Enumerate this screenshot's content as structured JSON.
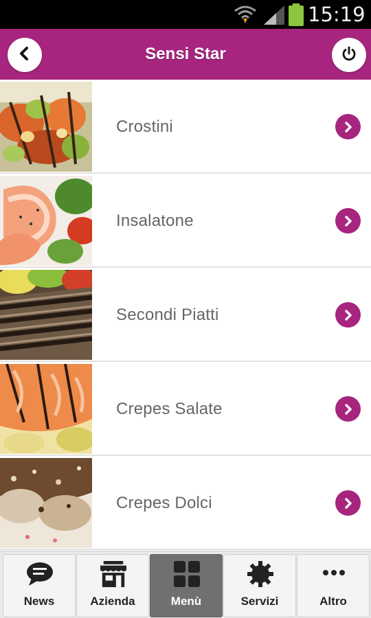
{
  "status_bar": {
    "time": "15:19",
    "icons": [
      "wifi-icon",
      "signal-icon",
      "battery-icon"
    ]
  },
  "header": {
    "title": "Sensi Star",
    "back_icon": "chevron-left-icon",
    "power_icon": "power-icon"
  },
  "menu": {
    "items": [
      {
        "label": "Crostini",
        "image": "crostini-photo"
      },
      {
        "label": "Insalatone",
        "image": "shrimp-salad-photo"
      },
      {
        "label": "Secondi Piatti",
        "image": "grilled-meat-photo"
      },
      {
        "label": "Crepes Salate",
        "image": "salmon-crepe-photo"
      },
      {
        "label": "Crepes Dolci",
        "image": "sweet-crepe-photo"
      }
    ]
  },
  "tabs": {
    "items": [
      {
        "label": "News",
        "icon": "chat-bubble-icon",
        "active": false
      },
      {
        "label": "Azienda",
        "icon": "store-icon",
        "active": false
      },
      {
        "label": "Menù",
        "icon": "grid-icon",
        "active": true
      },
      {
        "label": "Servizi",
        "icon": "gear-icon",
        "active": false
      },
      {
        "label": "Altro",
        "icon": "more-icon",
        "active": false
      }
    ]
  },
  "colors": {
    "brand": "#a7257f",
    "status_bar": "#000000",
    "battery": "#8cc63f",
    "tab_active": "#707070"
  }
}
